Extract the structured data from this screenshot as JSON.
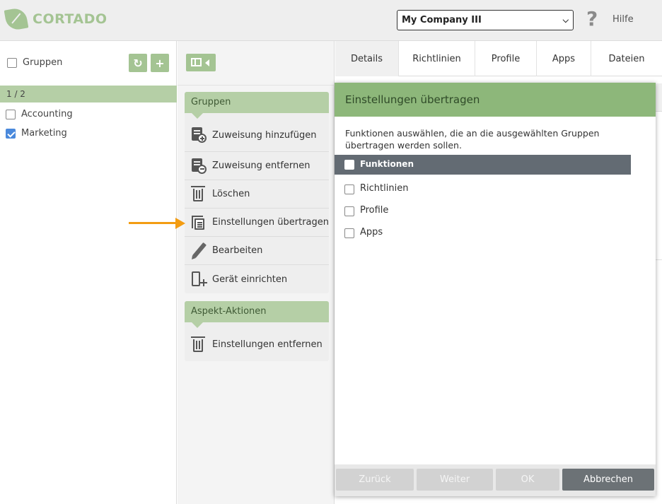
{
  "header": {
    "logo_text": "CORTADO",
    "company_select": "My Company III",
    "help_label": "Hilfe"
  },
  "left_panel": {
    "groups_label": "Gruppen",
    "count": "1 / 2",
    "items": [
      {
        "label": "Accounting",
        "checked": false
      },
      {
        "label": "Marketing",
        "checked": true
      }
    ]
  },
  "actions": {
    "groups_section": {
      "title": "Gruppen",
      "items": [
        {
          "label": "Zuweisung hinzufügen",
          "icon": "add-assignment-icon"
        },
        {
          "label": "Zuweisung entfernen",
          "icon": "remove-assignment-icon"
        },
        {
          "label": "Löschen",
          "icon": "trash-icon"
        },
        {
          "label": "Einstellungen übertragen",
          "icon": "copy-settings-icon"
        },
        {
          "label": "Bearbeiten",
          "icon": "pencil-icon"
        },
        {
          "label": "Gerät einrichten",
          "icon": "device-add-icon"
        }
      ]
    },
    "aspect_section": {
      "title": "Aspekt-Aktionen",
      "items": [
        {
          "label": "Einstellungen entfernen",
          "icon": "trash-icon"
        }
      ]
    }
  },
  "tabs": [
    "Details",
    "Richtlinien",
    "Profile",
    "Apps",
    "Dateien"
  ],
  "dialog": {
    "title": "Einstellungen übertragen",
    "description": "Funktionen auswählen, die an die ausgewählten Gruppen übertragen werden sollen.",
    "table_header": "Funktionen",
    "options": [
      "Richtlinien",
      "Profile",
      "Apps"
    ],
    "buttons": {
      "back": "Zurück",
      "next": "Weiter",
      "ok": "OK",
      "cancel": "Abbrechen"
    }
  },
  "colors": {
    "accent_green": "#a4c493",
    "dialog_header": "#8db77a",
    "table_header": "#636b73",
    "arrow": "#f39c12"
  }
}
